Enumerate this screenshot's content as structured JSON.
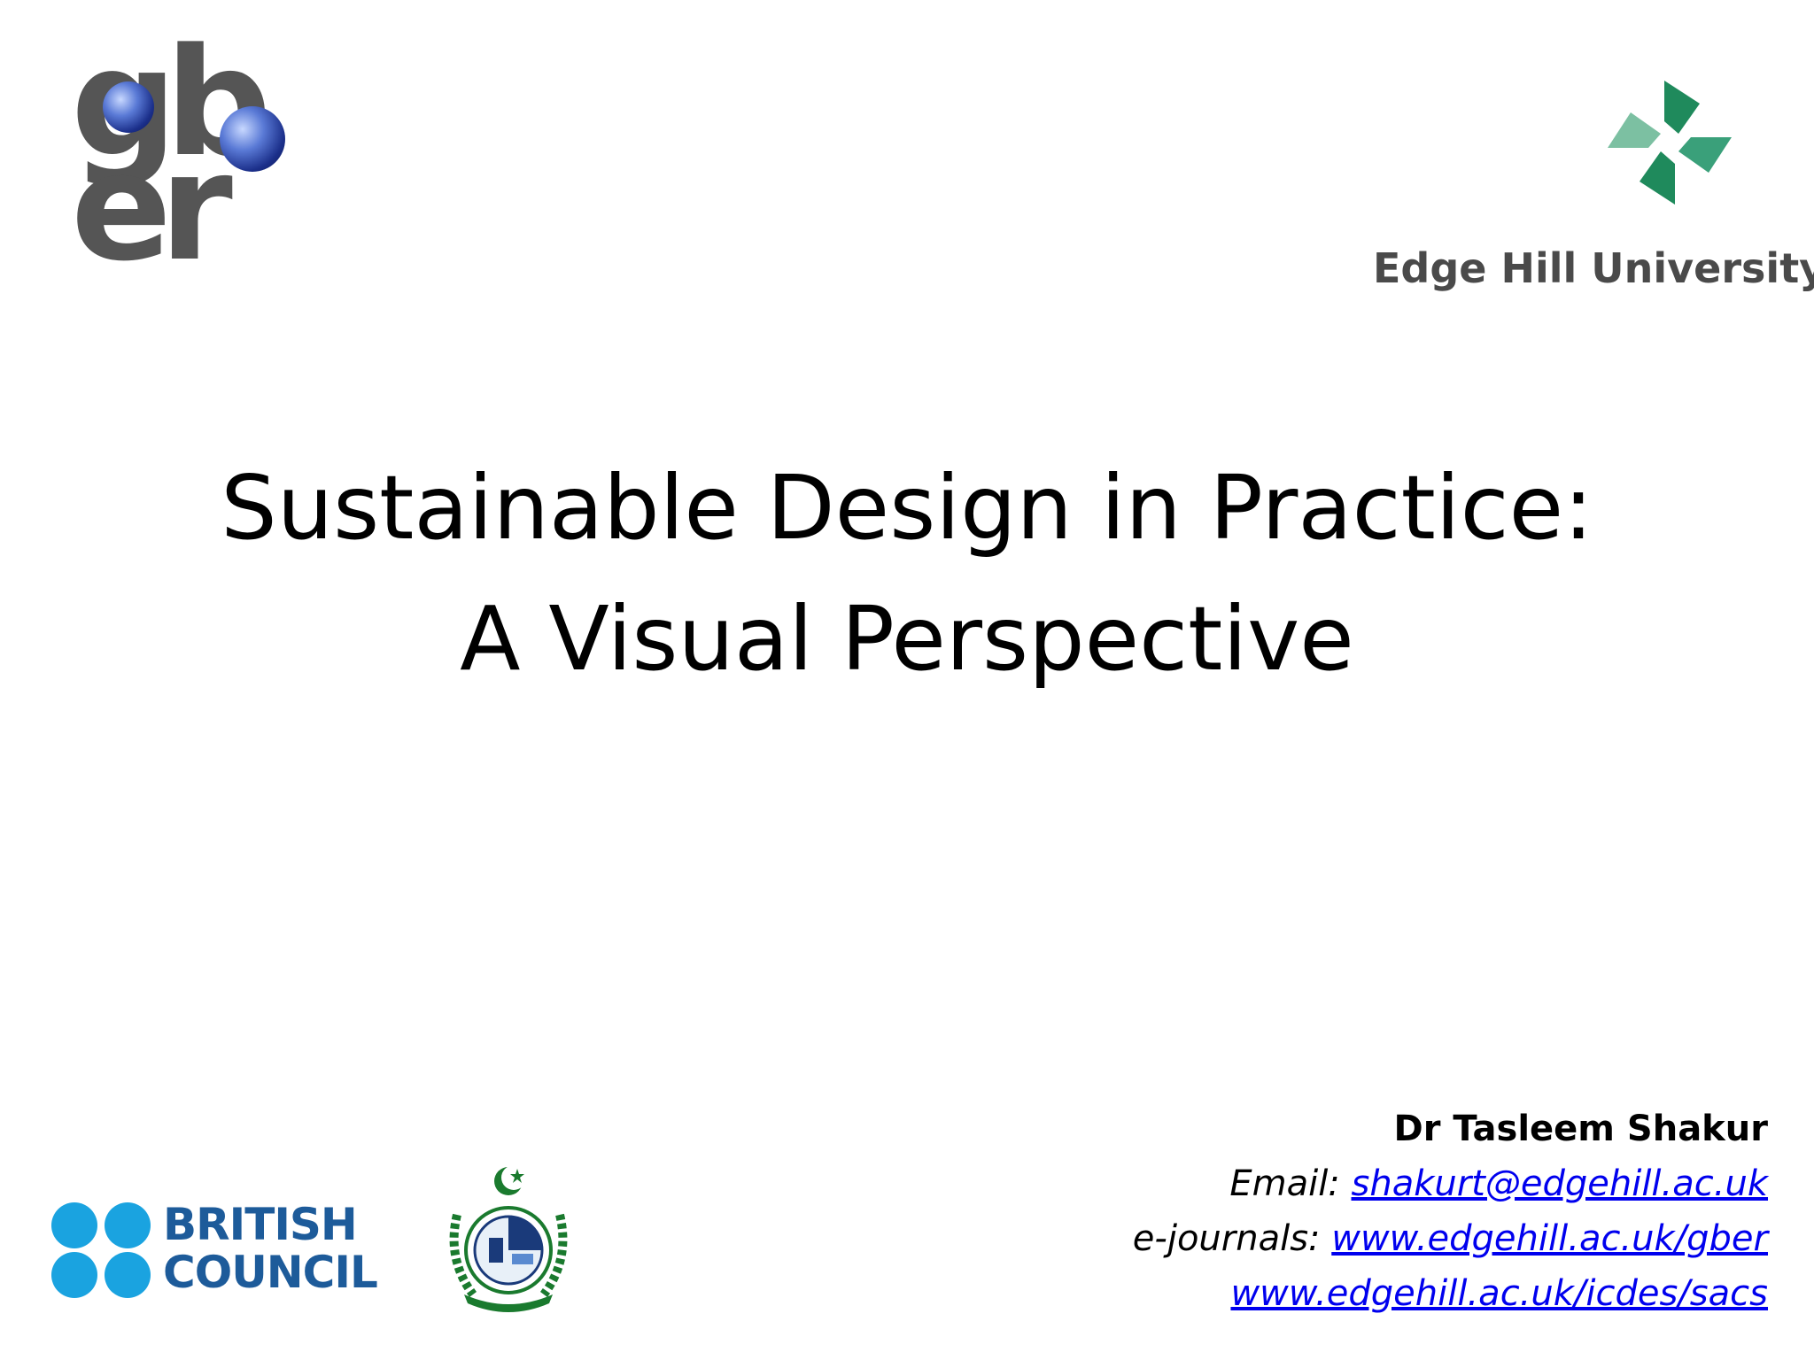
{
  "slide": {
    "title_line1": "Sustainable Design in Practice:",
    "title_line2": "A Visual Perspective"
  },
  "logos": {
    "gber": {
      "line1": "gb",
      "line2": "er"
    },
    "edge_hill": {
      "name": "Edge Hill University",
      "color": "#2e8b57"
    },
    "british_council": {
      "line1": "BRITISH",
      "line2": "COUNCIL",
      "dot_color": "#1aa3e0",
      "text_color": "#1d5b9a"
    },
    "hec": {
      "color": "#1a7a2e"
    }
  },
  "contact": {
    "author": "Dr Tasleem Shakur",
    "email_label": "Email: ",
    "email": "shakurt@edgehill.ac.uk",
    "ejournals_label": "e-journals: ",
    "ejournal_url1": "www.edgehill.ac.uk/gber",
    "ejournal_url2": "www.edgehill.ac.uk/icdes/sacs",
    "link_color": "#0000ee"
  }
}
